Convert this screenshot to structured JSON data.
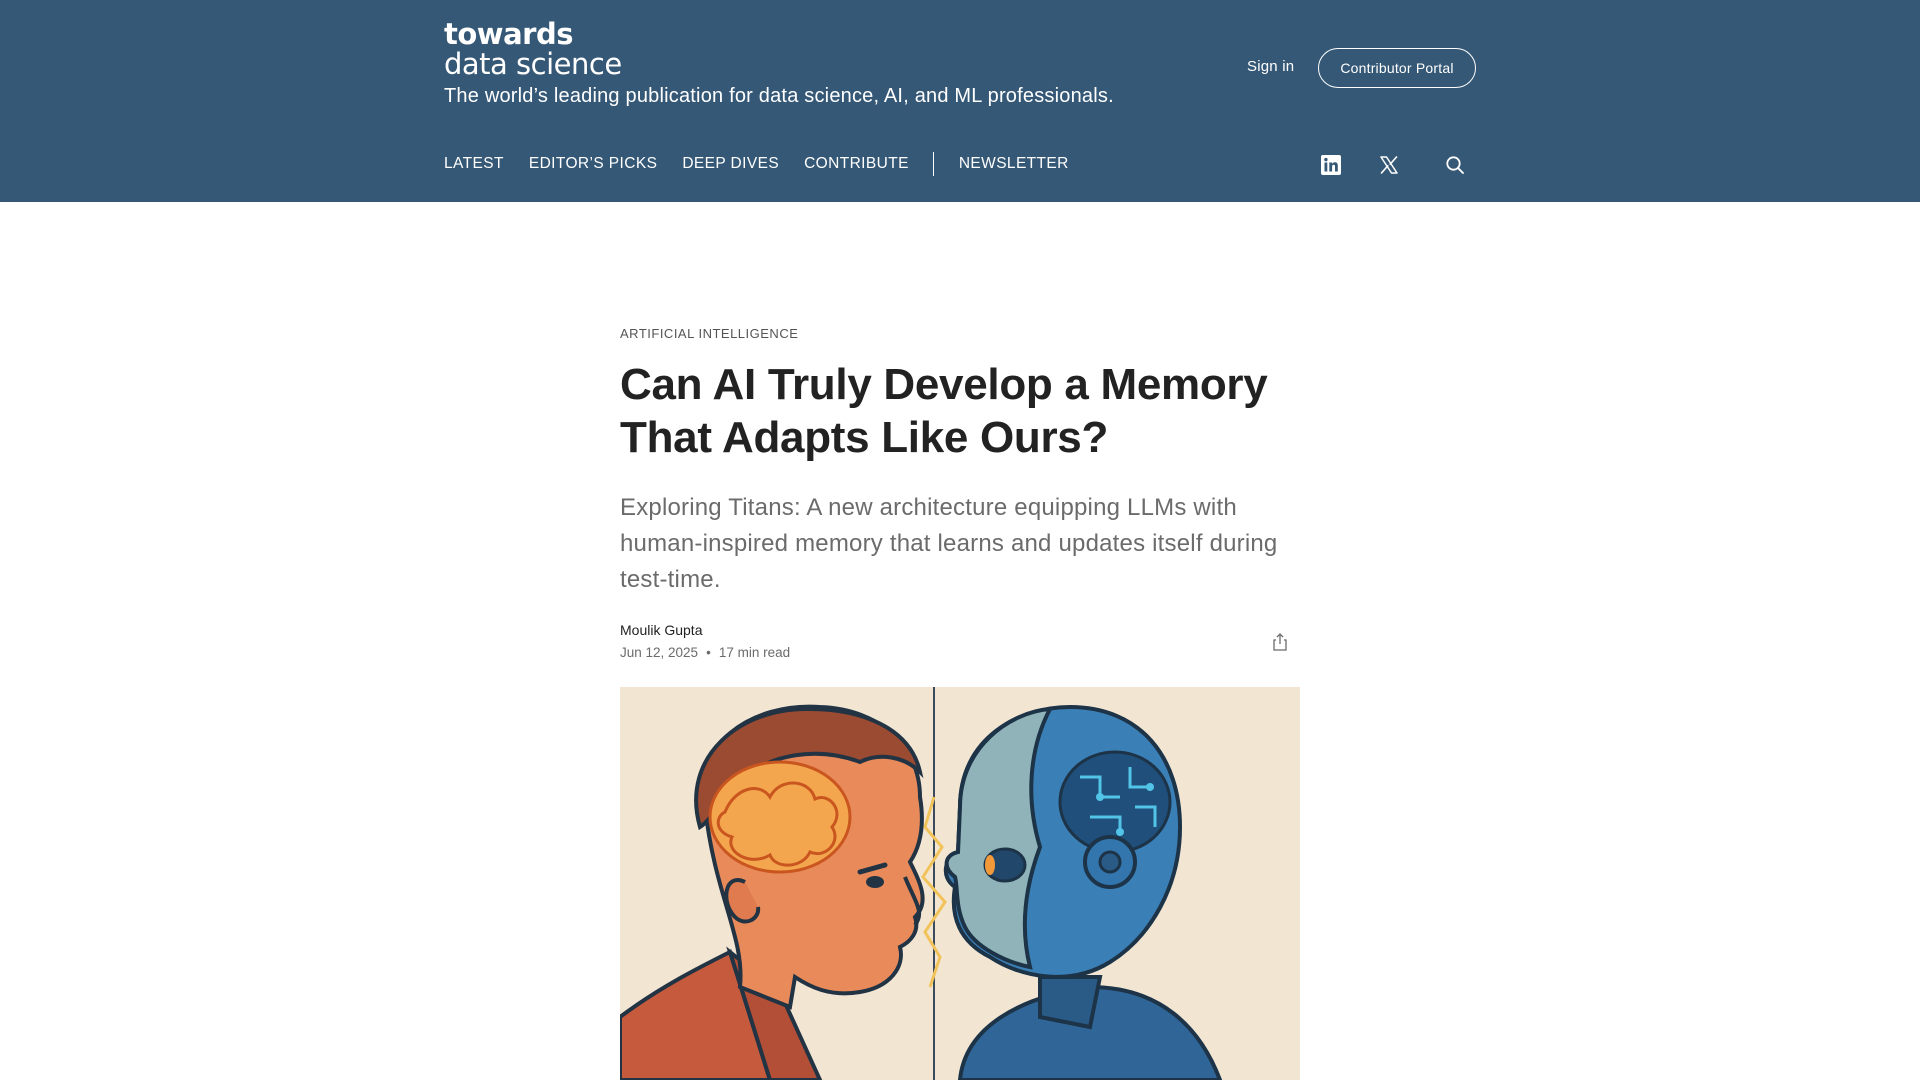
{
  "header": {
    "logo_line1": "towards",
    "logo_line2": "data science",
    "tagline": "The world’s leading publication for data science, AI, and ML professionals.",
    "sign_in": "Sign in",
    "contributor_portal": "Contributor Portal",
    "background_color": "#355876"
  },
  "nav": {
    "latest": "LATEST",
    "editors_picks": "EDITOR’S PICKS",
    "deep_dives": "DEEP DIVES",
    "contribute": "CONTRIBUTE",
    "newsletter": "NEWSLETTER"
  },
  "icons": {
    "linkedin": "linkedin-icon",
    "x": "x-icon",
    "search": "search-icon",
    "share": "share-icon"
  },
  "article": {
    "category": "ARTIFICIAL INTELLIGENCE",
    "title": "Can AI Truly Develop a Memory That Adapts Like Ours?",
    "subtitle": "Exploring Titans: A new architecture equipping LLMs with human-inspired memory that learns and updates itself during test-time.",
    "author": "Moulik Gupta",
    "date": "Jun 12, 2025",
    "separator": "•",
    "read_time": "17 min read"
  },
  "colors": {
    "title": "#222222",
    "subtitle": "#6b6b6b",
    "hero_background": "#f2e6d3"
  }
}
